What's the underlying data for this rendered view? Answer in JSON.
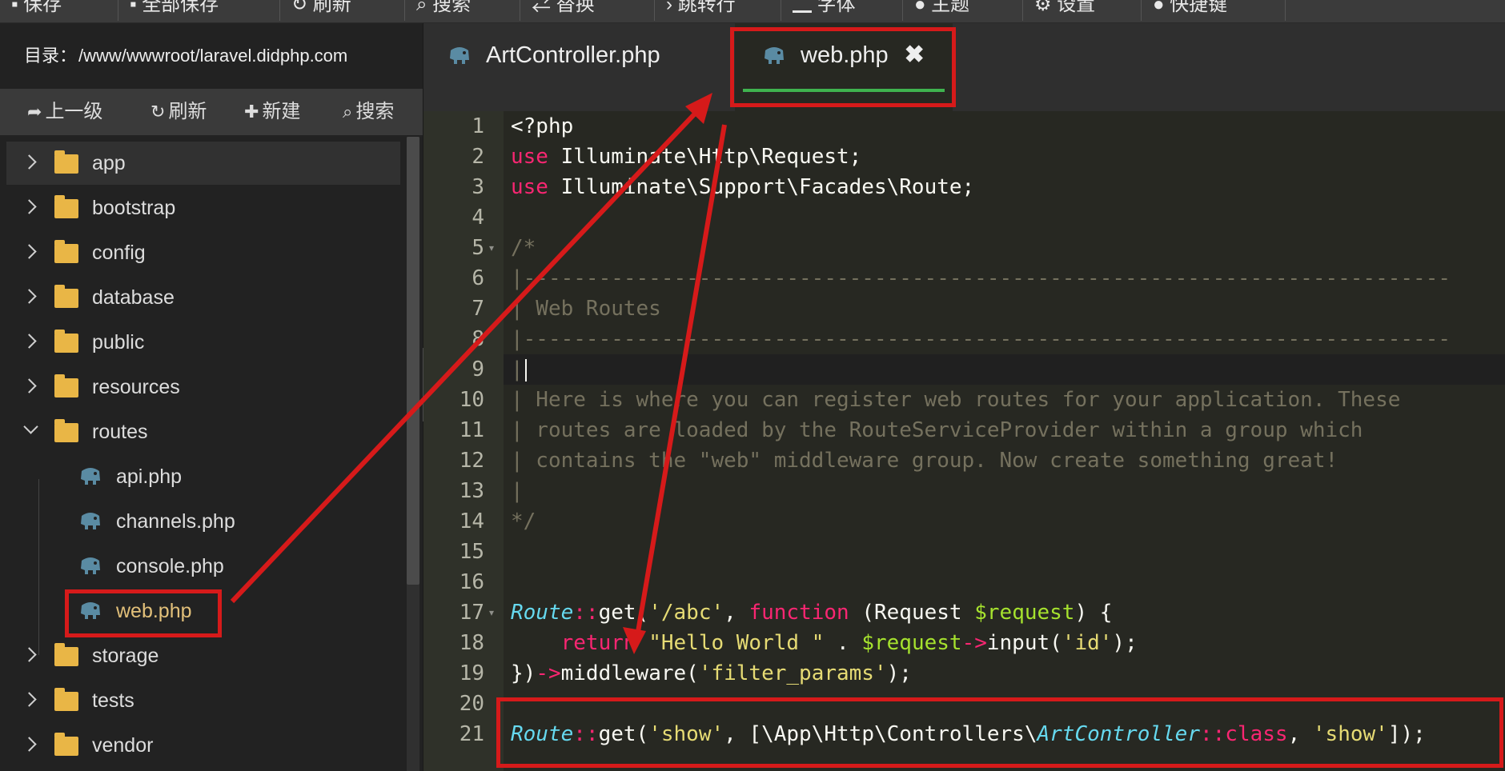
{
  "toolbar": {
    "items": [
      "保存",
      "全部保存",
      "刷新",
      "搜索",
      "替换",
      "跳转行",
      "字体",
      "主题",
      "设置",
      "快捷键"
    ]
  },
  "sidebar": {
    "dir_label": "目录：",
    "dir_path": "/www/wwwroot/laravel.didphp.com",
    "actions": {
      "up": "上一级",
      "refresh": "刷新",
      "new": "新建",
      "search": "搜索"
    },
    "tree": [
      {
        "type": "folder",
        "name": "app",
        "state": "collapsed",
        "selected": true
      },
      {
        "type": "folder",
        "name": "bootstrap",
        "state": "collapsed"
      },
      {
        "type": "folder",
        "name": "config",
        "state": "collapsed"
      },
      {
        "type": "folder",
        "name": "database",
        "state": "collapsed"
      },
      {
        "type": "folder",
        "name": "public",
        "state": "collapsed"
      },
      {
        "type": "folder",
        "name": "resources",
        "state": "collapsed"
      },
      {
        "type": "folder",
        "name": "routes",
        "state": "expanded"
      },
      {
        "type": "file",
        "name": "api.php"
      },
      {
        "type": "file",
        "name": "channels.php"
      },
      {
        "type": "file",
        "name": "console.php"
      },
      {
        "type": "file",
        "name": "web.php",
        "active": true
      },
      {
        "type": "folder",
        "name": "storage",
        "state": "collapsed"
      },
      {
        "type": "folder",
        "name": "tests",
        "state": "collapsed"
      },
      {
        "type": "folder",
        "name": "vendor",
        "state": "collapsed"
      }
    ]
  },
  "editor": {
    "tabs": [
      {
        "name": "ArtController.php",
        "active": false
      },
      {
        "name": "web.php",
        "active": true,
        "close": "✖"
      }
    ],
    "current_line": 9,
    "lines": [
      [
        [
          "",
          "<?php"
        ]
      ],
      [
        [
          "kw",
          "use"
        ],
        [
          "",
          " Illuminate\\Http\\Request;"
        ]
      ],
      [
        [
          "kw",
          "use"
        ],
        [
          "",
          " Illuminate\\Support\\Facades\\Route;"
        ]
      ],
      [],
      [
        [
          "cm",
          "/*"
        ]
      ],
      [
        [
          "cm",
          "|--------------------------------------------------------------------------"
        ]
      ],
      [
        [
          "cm",
          "| Web Routes"
        ]
      ],
      [
        [
          "cm",
          "|--------------------------------------------------------------------------"
        ]
      ],
      [
        [
          "cm",
          "|"
        ]
      ],
      [
        [
          "cm",
          "| Here is where you can register web routes for your application. These"
        ]
      ],
      [
        [
          "cm",
          "| routes are loaded by the RouteServiceProvider within a group which"
        ]
      ],
      [
        [
          "cm",
          "| contains the \"web\" middleware group. Now create something great!"
        ]
      ],
      [
        [
          "cm",
          "|"
        ]
      ],
      [
        [
          "cm",
          "*/"
        ]
      ],
      [],
      [],
      [
        [
          "cls",
          "Route"
        ],
        [
          "op",
          "::"
        ],
        [
          "",
          "get("
        ],
        [
          "str",
          "'/abc'"
        ],
        [
          "",
          ", "
        ],
        [
          "fn",
          "function"
        ],
        [
          "",
          " (Request "
        ],
        [
          "var",
          "$request"
        ],
        [
          "",
          ") {"
        ]
      ],
      [
        [
          "",
          "    "
        ],
        [
          "kw",
          "return"
        ],
        [
          "",
          " "
        ],
        [
          "str",
          "\"Hello World \""
        ],
        [
          "",
          " . "
        ],
        [
          "var",
          "$request"
        ],
        [
          "op",
          "->"
        ],
        [
          "",
          "input("
        ],
        [
          "str",
          "'id'"
        ],
        [
          "",
          ");"
        ]
      ],
      [
        [
          "",
          "})"
        ],
        [
          "op",
          "->"
        ],
        [
          "",
          "middleware("
        ],
        [
          "str",
          "'filter_params'"
        ],
        [
          "",
          ");"
        ]
      ],
      [],
      [
        [
          "cls",
          "Route"
        ],
        [
          "op",
          "::"
        ],
        [
          "",
          "get("
        ],
        [
          "str",
          "'show'"
        ],
        [
          "",
          ", [\\App\\Http\\Controllers\\"
        ],
        [
          "cls",
          "ArtController"
        ],
        [
          "op",
          "::"
        ],
        [
          "kw",
          "class"
        ],
        [
          "",
          ", "
        ],
        [
          "str",
          "'show'"
        ],
        [
          "",
          "]);"
        ]
      ]
    ],
    "fold_lines": [
      5,
      17
    ]
  },
  "colors": {
    "editor_bg": "#272822",
    "keyword": "#f92672",
    "class": "#66d9ef",
    "string": "#e6db74",
    "variable": "#a6e22e",
    "comment": "#75715e",
    "folder": "#e9b646",
    "php_icon": "#5a8ba3",
    "active_tab_underline": "#3fb34f",
    "annotation": "#d61a1a"
  }
}
